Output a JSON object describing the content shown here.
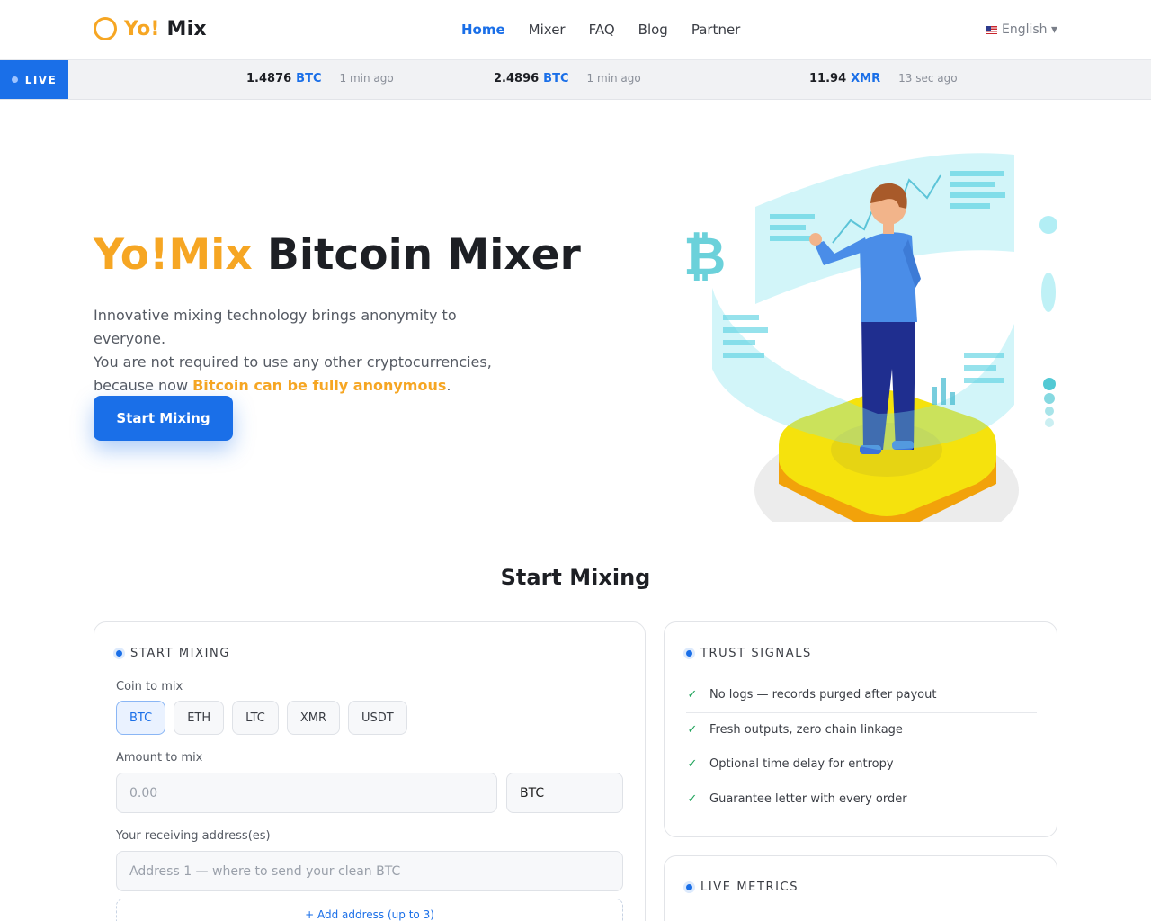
{
  "header": {
    "logo_yo": "Yo!",
    "logo_mix": "Mix",
    "nav": [
      "Home",
      "Mixer",
      "FAQ",
      "Blog",
      "Partner"
    ],
    "active_nav": "Home",
    "language": "English ▾"
  },
  "ticker": {
    "live_label": "LIVE",
    "items": [
      {
        "amount": "1.4876",
        "coin": "BTC",
        "time": "1 min ago"
      },
      {
        "amount": "2.4896",
        "coin": "BTC",
        "time": "1 min ago"
      },
      {
        "amount": "11.94",
        "coin": "XMR",
        "time": "13 sec ago"
      }
    ]
  },
  "hero": {
    "title_brand": "Yo!Mix",
    "title_rest": "Bitcoin Mixer",
    "desc_line1": "Innovative mixing technology brings anonymity to everyone.",
    "desc_line2": "You are not required to use any other cryptocurrencies,",
    "desc_line3_prefix": "because now ",
    "desc_highlight": "Bitcoin can be fully anonymous",
    "desc_suffix": ".",
    "cta_label": "Start Mixing"
  },
  "section": {
    "title": "Start Mixing"
  },
  "mix_form": {
    "heading": "START MIXING",
    "coin_label": "Coin to mix",
    "coins": [
      "BTC",
      "ETH",
      "LTC",
      "XMR",
      "USDT"
    ],
    "selected_coin": "BTC",
    "amount_label": "Amount to mix",
    "amount_placeholder": "0.00",
    "amount_unit": "BTC",
    "address_label": "Your receiving address(es)",
    "address_placeholder": "Address 1 — where to send your clean BTC",
    "add_address_label": "+ Add address (up to 3)"
  },
  "trust": {
    "heading": "TRUST SIGNALS",
    "items": [
      "No logs — records purged after payout",
      "Fresh outputs, zero chain linkage",
      "Optional time delay for entropy",
      "Guarantee letter with every order"
    ]
  },
  "metrics": {
    "heading": "LIVE METRICS"
  },
  "colors": {
    "accent": "#1a6fe8",
    "brand": "#f6a623",
    "check": "#1ea35a"
  }
}
